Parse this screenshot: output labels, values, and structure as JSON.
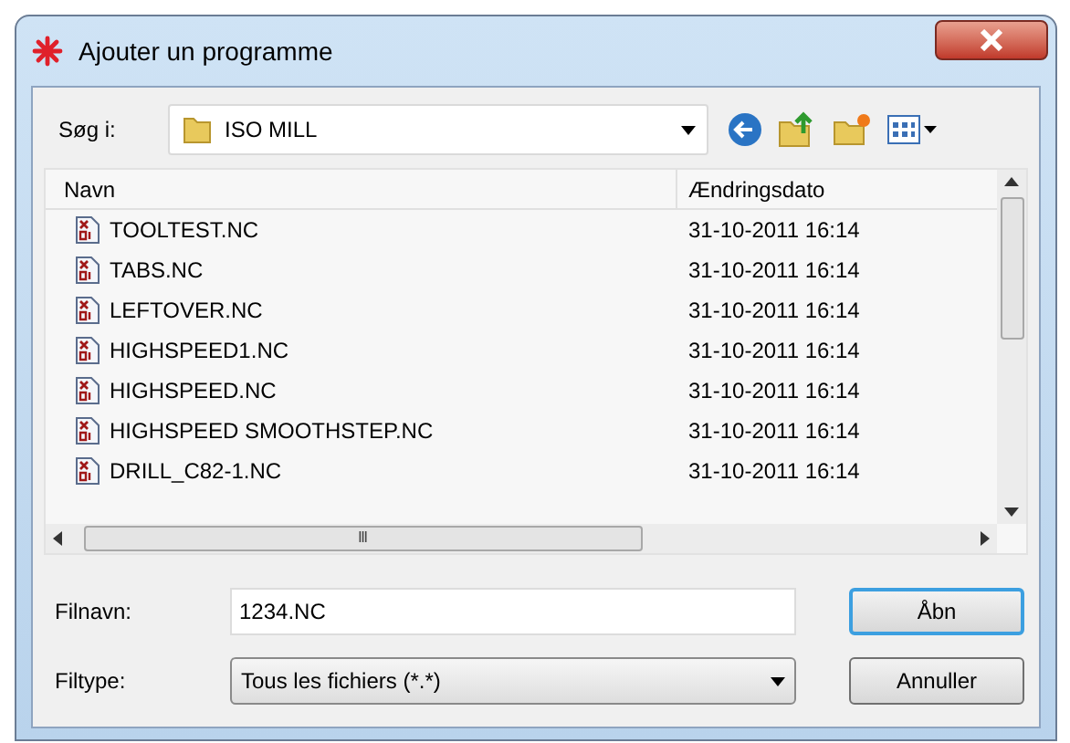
{
  "window": {
    "title": "Ajouter un programme"
  },
  "look_in": {
    "label": "Søg i:",
    "value": "ISO MILL"
  },
  "file_list": {
    "columns": [
      "Navn",
      "Ændringsdato"
    ],
    "rows": [
      {
        "name": "TOOLTEST.NC",
        "date": "31-10-2011 16:14"
      },
      {
        "name": "TABS.NC",
        "date": "31-10-2011 16:14"
      },
      {
        "name": "LEFTOVER.NC",
        "date": "31-10-2011 16:14"
      },
      {
        "name": "HIGHSPEED1.NC",
        "date": "31-10-2011 16:14"
      },
      {
        "name": "HIGHSPEED.NC",
        "date": "31-10-2011 16:14"
      },
      {
        "name": "HIGHSPEED SMOOTHSTEP.NC",
        "date": "31-10-2011 16:14"
      },
      {
        "name": "DRILL_C82-1.NC",
        "date": "31-10-2011 16:14"
      }
    ],
    "scroll_thumb": "Ⅲ"
  },
  "file_name": {
    "label": "Filnavn:",
    "value": "1234.NC"
  },
  "file_type": {
    "label": "Filtype:",
    "value": "Tous les fichiers (*.*)"
  },
  "buttons": [
    {
      "label": "Åbn",
      "default": true
    },
    {
      "label": "Annuller",
      "default": false
    }
  ]
}
